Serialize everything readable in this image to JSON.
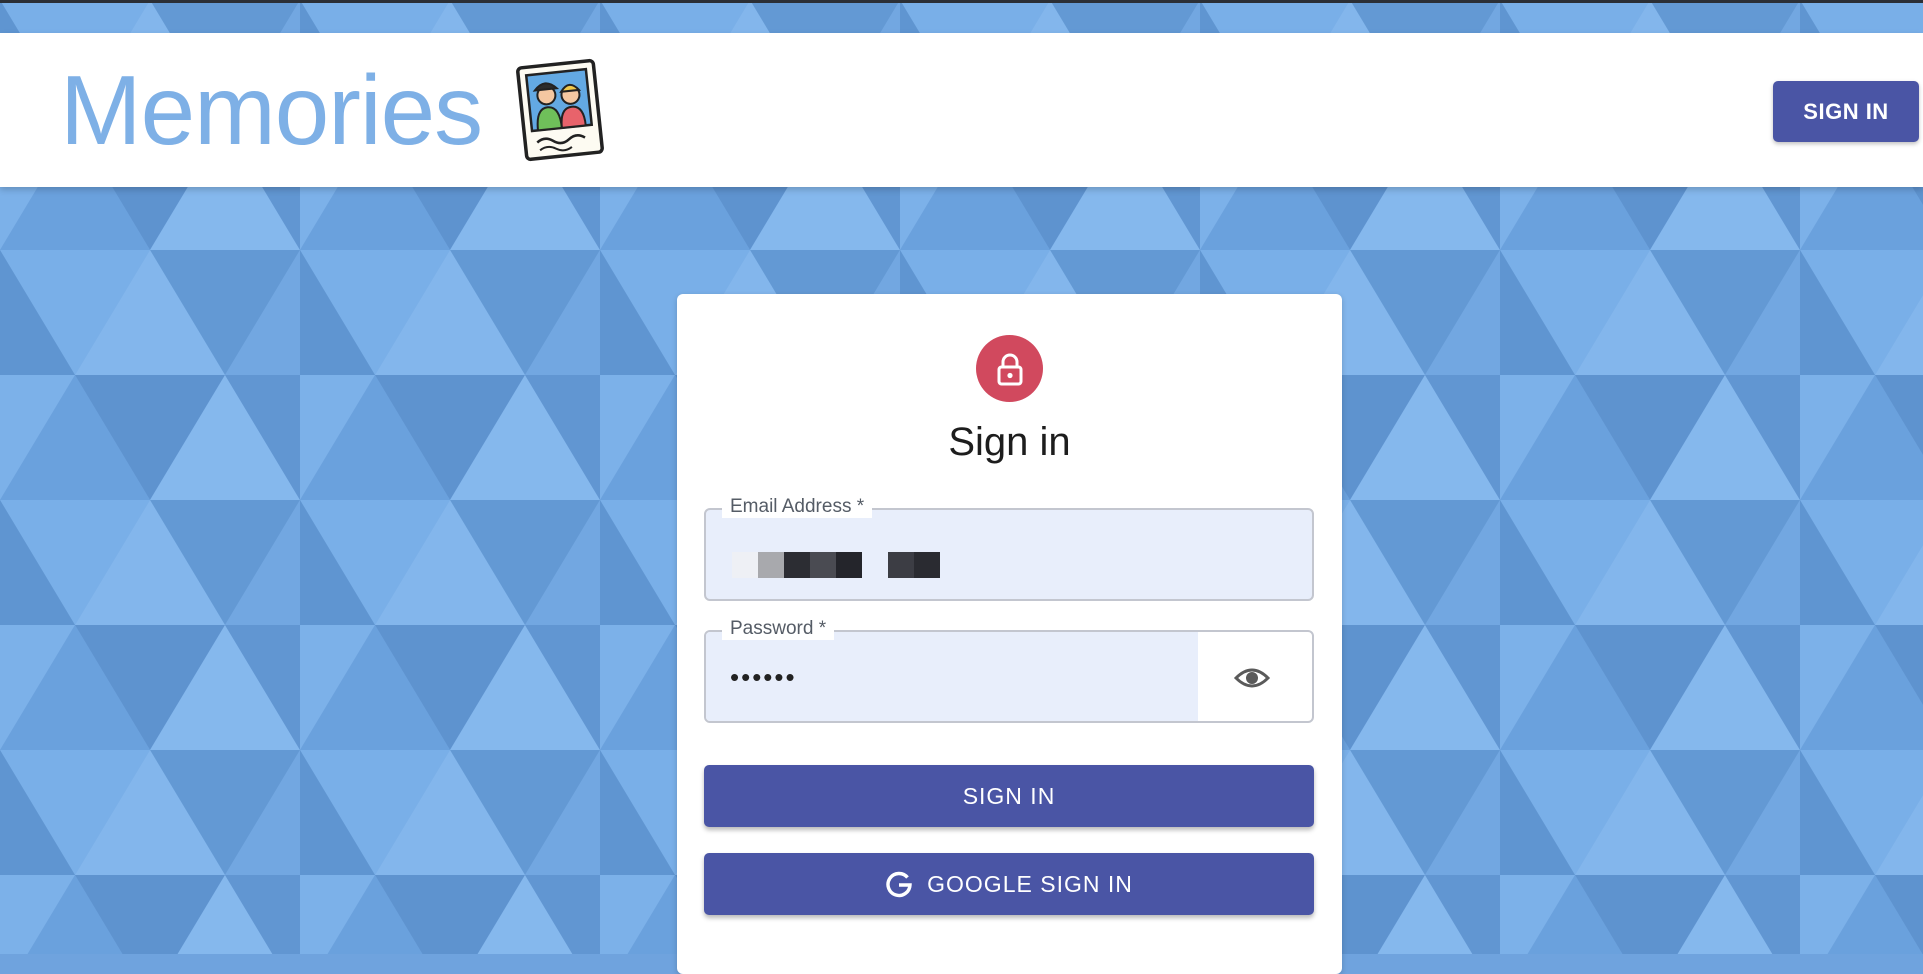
{
  "header": {
    "brand_title": "Memories",
    "logo_icon": "photo-memories-icon",
    "sign_in_label": "SIGN IN"
  },
  "signin_form": {
    "lock_icon": "lock-icon",
    "title": "Sign in",
    "email": {
      "label": "Email Address *",
      "value_redacted": true
    },
    "password": {
      "label": "Password *",
      "value": "••••••",
      "toggle_icon": "eye-icon"
    },
    "submit_label": "SIGN IN",
    "google_label": "GOOGLE SIGN IN",
    "google_icon": "google-g-icon"
  },
  "colors": {
    "brand_text": "#7eb0e6",
    "primary_button": "#4a55a5",
    "avatar": "#d1495e",
    "field_fill": "#e8eefb",
    "background": "#6fa3de"
  }
}
